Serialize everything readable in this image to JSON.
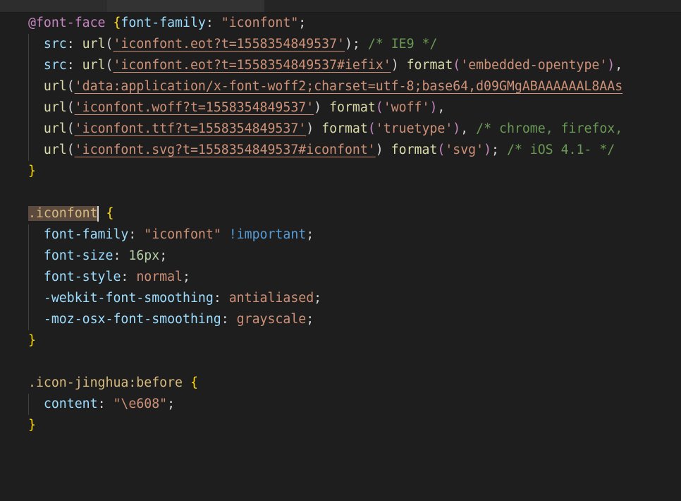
{
  "code": {
    "font_face_rule": {
      "at_rule": "@font-face",
      "open_brace": "{",
      "family_prop": "font-family",
      "family_value": "\"iconfont\"",
      "src1_prop": "src",
      "src1_fn": "url",
      "src1_url": "'iconfont.eot?t=1558354849537'",
      "src1_comment": "/* IE9 */",
      "src2_prop": "src",
      "src2_fn": "url",
      "src2_url": "'iconfont.eot?t=1558354849537#iefix'",
      "src2_format_fn": "format",
      "src2_format": "'embedded-opentype'",
      "src3_fn": "url",
      "src3_url": "'data:application/x-font-woff2;charset=utf-8;base64,d09GMgABAAAAAAL8AAs",
      "src4_fn": "url",
      "src4_url": "'iconfont.woff?t=1558354849537'",
      "src4_format_fn": "format",
      "src4_format": "'woff'",
      "src5_fn": "url",
      "src5_url": "'iconfont.ttf?t=1558354849537'",
      "src5_format_fn": "format",
      "src5_format": "'truetype'",
      "src5_comment": "/* chrome, firefox,",
      "src6_fn": "url",
      "src6_url": "'iconfont.svg?t=1558354849537#iconfont'",
      "src6_format_fn": "format",
      "src6_format": "'svg'",
      "src6_comment": "/* iOS 4.1- */",
      "close_brace": "}"
    },
    "iconfont_rule": {
      "selector": ".iconfont",
      "open_brace": "{",
      "decl1_prop": "font-family",
      "decl1_value": "\"iconfont\"",
      "decl1_important": "!important",
      "decl2_prop": "font-size",
      "decl2_value": "16px",
      "decl3_prop": "font-style",
      "decl3_value": "normal",
      "decl4_prop": "-webkit-font-smoothing",
      "decl4_value": "antialiased",
      "decl5_prop": "-moz-osx-font-smoothing",
      "decl5_value": "grayscale",
      "close_brace": "}"
    },
    "jinghua_rule": {
      "selector": ".icon-jinghua:before",
      "open_brace": "{",
      "decl1_prop": "content",
      "decl1_value": "\"\\e608\"",
      "close_brace": "}"
    }
  },
  "colors": {
    "background": "#1e1e1e",
    "keyword": "#c586c0",
    "selector": "#d7ba7d",
    "property": "#9cdcfe",
    "string": "#ce9178",
    "function": "#dcdcaa",
    "comment": "#6a9955",
    "number": "#b5cea8",
    "important": "#569cd6",
    "brace": "#ffd700"
  }
}
